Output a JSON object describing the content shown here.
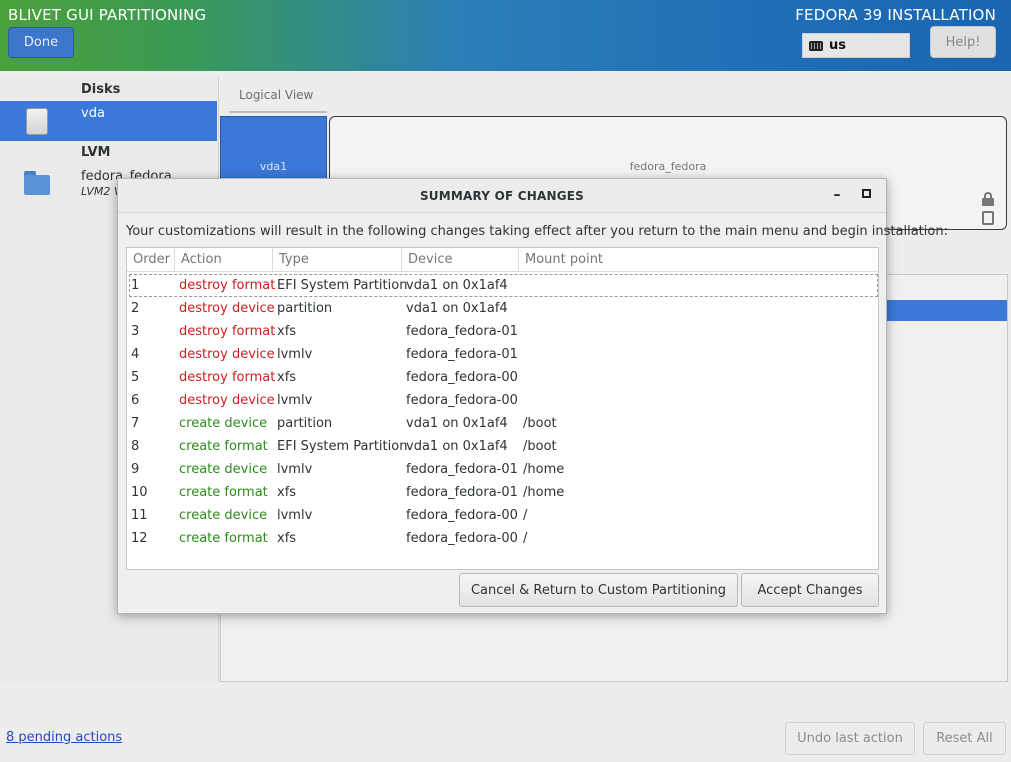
{
  "header": {
    "app_title": "BLIVET GUI PARTITIONING",
    "installer_title": "FEDORA 39 INSTALLATION",
    "done_label": "Done",
    "help_label": "Help!",
    "keyboard_layout": "us"
  },
  "sidebar": {
    "disks_title": "Disks",
    "disk_name": "vda",
    "lvm_title": "LVM",
    "lvm_name": "fedora_fedora",
    "lvm_type": "LVM2 V"
  },
  "main": {
    "tab_logical": "Logical View",
    "block_vda1": "vda1",
    "block_fedora": "fedora_fedora"
  },
  "bottom": {
    "pending_actions": "8 pending actions",
    "undo_label": "Undo last action",
    "reset_label": "Reset All"
  },
  "dialog": {
    "title": "SUMMARY OF CHANGES",
    "minimize_glyph": "–",
    "description": "Your customizations will result in the following changes taking effect after you return to the main menu and begin installation:",
    "columns": [
      "Order",
      "Action",
      "Type",
      "Device",
      "Mount point"
    ],
    "rows": [
      {
        "order": "1",
        "action": "destroy format",
        "type": "EFI System Partition",
        "device": "vda1 on 0x1af4",
        "mount": "",
        "kind": "destroy"
      },
      {
        "order": "2",
        "action": "destroy device",
        "type": "partition",
        "device": "vda1 on 0x1af4",
        "mount": "",
        "kind": "destroy"
      },
      {
        "order": "3",
        "action": "destroy format",
        "type": "xfs",
        "device": "fedora_fedora-01",
        "mount": "",
        "kind": "destroy"
      },
      {
        "order": "4",
        "action": "destroy device",
        "type": "lvmlv",
        "device": "fedora_fedora-01",
        "mount": "",
        "kind": "destroy"
      },
      {
        "order": "5",
        "action": "destroy format",
        "type": "xfs",
        "device": "fedora_fedora-00",
        "mount": "",
        "kind": "destroy"
      },
      {
        "order": "6",
        "action": "destroy device",
        "type": "lvmlv",
        "device": "fedora_fedora-00",
        "mount": "",
        "kind": "destroy"
      },
      {
        "order": "7",
        "action": "create device",
        "type": "partition",
        "device": "vda1 on 0x1af4",
        "mount": "/boot",
        "kind": "create"
      },
      {
        "order": "8",
        "action": "create format",
        "type": "EFI System Partition",
        "device": "vda1 on 0x1af4",
        "mount": "/boot",
        "kind": "create"
      },
      {
        "order": "9",
        "action": "create device",
        "type": "lvmlv",
        "device": "fedora_fedora-01",
        "mount": "/home",
        "kind": "create"
      },
      {
        "order": "10",
        "action": "create format",
        "type": "xfs",
        "device": "fedora_fedora-01",
        "mount": "/home",
        "kind": "create"
      },
      {
        "order": "11",
        "action": "create device",
        "type": "lvmlv",
        "device": "fedora_fedora-00",
        "mount": "/",
        "kind": "create"
      },
      {
        "order": "12",
        "action": "create format",
        "type": "xfs",
        "device": "fedora_fedora-00",
        "mount": "/",
        "kind": "create"
      }
    ],
    "cancel_label": "Cancel & Return to Custom Partitioning",
    "accept_label": "Accept Changes"
  },
  "colors": {
    "destroy": "#cc1f1f",
    "create": "#2e8b1e",
    "accent": "#3c78d8"
  }
}
